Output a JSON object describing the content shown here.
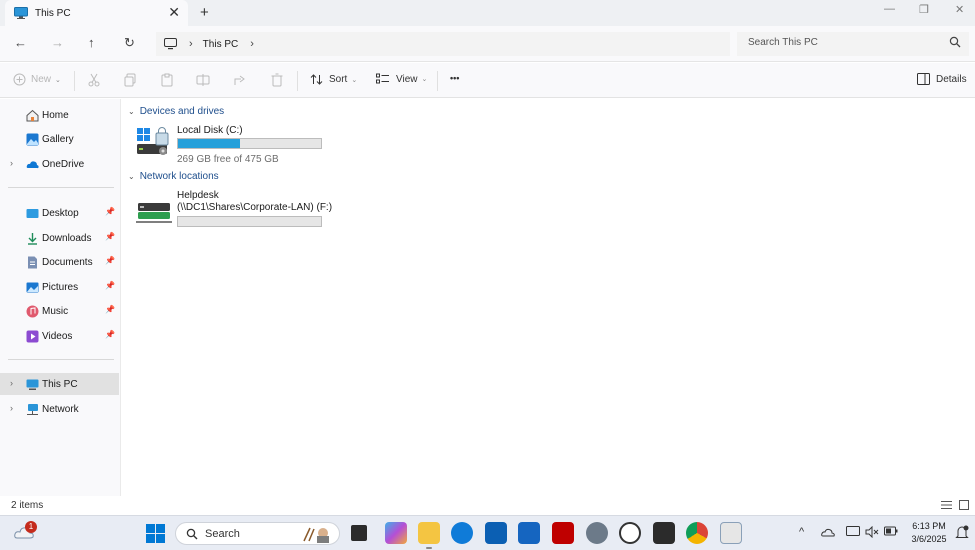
{
  "window": {
    "tab_title": "This PC",
    "close_glyph": "✕",
    "new_tab_glyph": "+",
    "minimize_glyph": "—",
    "maximize_glyph": "❐",
    "window_close_glyph": "✕"
  },
  "nav": {
    "back_glyph": "←",
    "forward_glyph": "→",
    "up_glyph": "↑",
    "refresh_glyph": "↻",
    "breadcrumb": [
      "This PC"
    ],
    "breadcrumb_sep": "›",
    "search_placeholder": "Search This PC"
  },
  "commandbar": {
    "new_label": "New",
    "sort_label": "Sort",
    "view_label": "View",
    "more_label": "•••",
    "details_label": "Details",
    "caret": "⌄"
  },
  "sidebar": {
    "items_top": [
      {
        "label": "Home",
        "icon": "home-icon"
      },
      {
        "label": "Gallery",
        "icon": "gallery-icon"
      },
      {
        "label": "OneDrive",
        "icon": "onedrive-icon"
      }
    ],
    "pinned": [
      {
        "label": "Desktop",
        "icon": "desktop-icon"
      },
      {
        "label": "Downloads",
        "icon": "downloads-icon"
      },
      {
        "label": "Documents",
        "icon": "documents-icon"
      },
      {
        "label": "Pictures",
        "icon": "pictures-icon"
      },
      {
        "label": "Music",
        "icon": "music-icon"
      },
      {
        "label": "Videos",
        "icon": "videos-icon"
      }
    ],
    "items_bottom": [
      {
        "label": "This PC",
        "icon": "this-pc-icon",
        "selected": true
      },
      {
        "label": "Network",
        "icon": "network-icon"
      }
    ],
    "chevron": "›",
    "pin_glyph": "📌"
  },
  "content": {
    "group1_title": "Devices and drives",
    "group2_title": "Network locations",
    "group_chevron": "⌄",
    "local_disk": {
      "name": "Local Disk (C:)",
      "free_text": "269 GB free of 475 GB",
      "used_fraction": 0.434
    },
    "network_drive": {
      "name": "Helpdesk",
      "path": "(\\\\DC1\\Shares\\Corporate-LAN) (F:)",
      "used_fraction": 0.0
    }
  },
  "status": {
    "item_count": "2 items"
  },
  "taskbar": {
    "search_placeholder": "Search",
    "notification_badge": "1",
    "clock_time": "6:13 PM",
    "clock_date": "3/6/2025",
    "tray_chevron": "^",
    "colors": {
      "accent": "#0078d4",
      "edge": "#0f7bd8",
      "chrome_red": "#db4437",
      "filezilla": "#bf0000",
      "terminal": "#2b2b2b"
    }
  },
  "colors": {
    "drive_bar_fill": "#26a0da",
    "group_header": "#1e4e8c",
    "selected_sidebar": "#e1e1e1"
  }
}
